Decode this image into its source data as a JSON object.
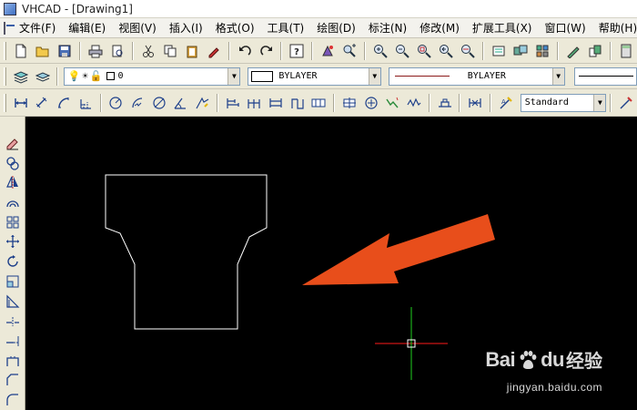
{
  "window": {
    "title": "VHCAD - [Drawing1]"
  },
  "menu": [
    {
      "label": "文件(F)"
    },
    {
      "label": "编辑(E)"
    },
    {
      "label": "视图(V)"
    },
    {
      "label": "插入(I)"
    },
    {
      "label": "格式(O)"
    },
    {
      "label": "工具(T)"
    },
    {
      "label": "绘图(D)"
    },
    {
      "label": "标注(N)"
    },
    {
      "label": "修改(M)"
    },
    {
      "label": "扩展工具(X)"
    },
    {
      "label": "窗口(W)"
    },
    {
      "label": "帮助(H)"
    }
  ],
  "properties": {
    "layer_value": "0",
    "color_value": "BYLAYER",
    "linetype_value": "BYLAYER",
    "text_style_value": "Standard"
  },
  "colors": {
    "canvas_background": "#000000",
    "shape_stroke": "#ffffff",
    "arrow_fill": "#e84e1b",
    "crosshair_horizontal": "#ff1a1a",
    "crosshair_vertical": "#1fd11f"
  },
  "watermark": {
    "brand_prefix": "Bai",
    "brand_suffix": "du",
    "brand_cn": "经验",
    "url": "jingyan.baidu.com"
  }
}
